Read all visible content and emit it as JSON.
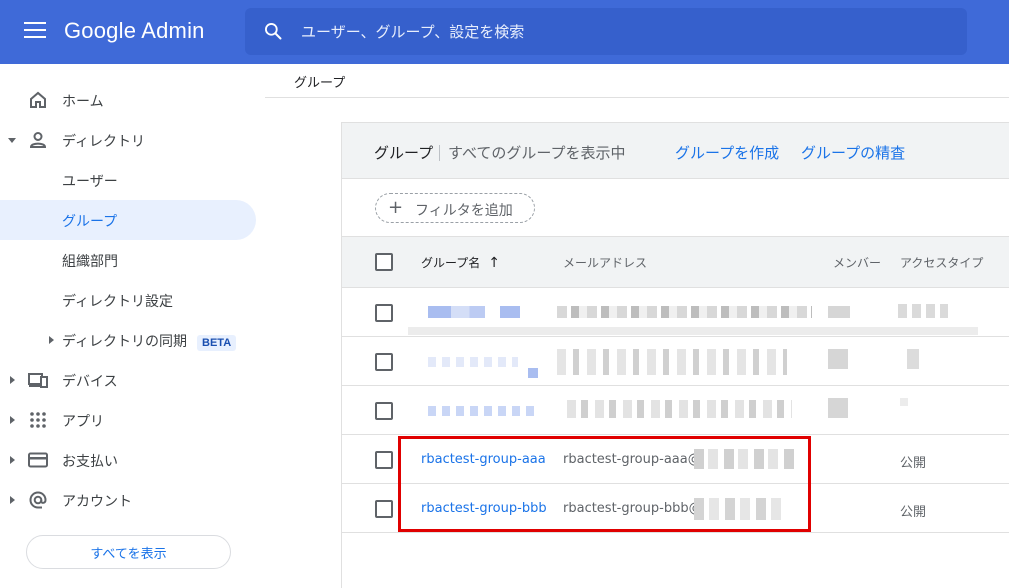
{
  "app": {
    "title": "Google Admin"
  },
  "search": {
    "placeholder": "ユーザー、グループ、設定を検索"
  },
  "sidebar": {
    "items": [
      {
        "label": "ホーム"
      },
      {
        "label": "ディレクトリ"
      },
      {
        "label": "ユーザー"
      },
      {
        "label": "グループ"
      },
      {
        "label": "組織部門"
      },
      {
        "label": "ディレクトリ設定"
      },
      {
        "label": "ディレクトリの同期",
        "badge": "BETA"
      },
      {
        "label": "デバイス"
      },
      {
        "label": "アプリ"
      },
      {
        "label": "お支払い"
      },
      {
        "label": "アカウント"
      }
    ],
    "show_all": "すべてを表示"
  },
  "breadcrumb": {
    "current": "グループ"
  },
  "groups_panel": {
    "title": "グループ",
    "subtitle": "すべてのグループを表示中",
    "create_link": "グループを作成",
    "inspect_link": "グループの精査",
    "filter_label": "フィルタを追加",
    "columns": {
      "name": "グループ名",
      "email": "メールアドレス",
      "members": "メンバー",
      "access": "アクセスタイプ"
    },
    "rows": [
      {
        "name": "rbactest-group-aaa",
        "email": "rbactest-group-aaa@",
        "access": "公開"
      },
      {
        "name": "rbactest-group-bbb",
        "email": "rbactest-group-bbb@",
        "access": "公開"
      }
    ]
  },
  "colors": {
    "brand": "#3f6ad8",
    "link": "#1a73e8",
    "highlight": "#e00000"
  }
}
